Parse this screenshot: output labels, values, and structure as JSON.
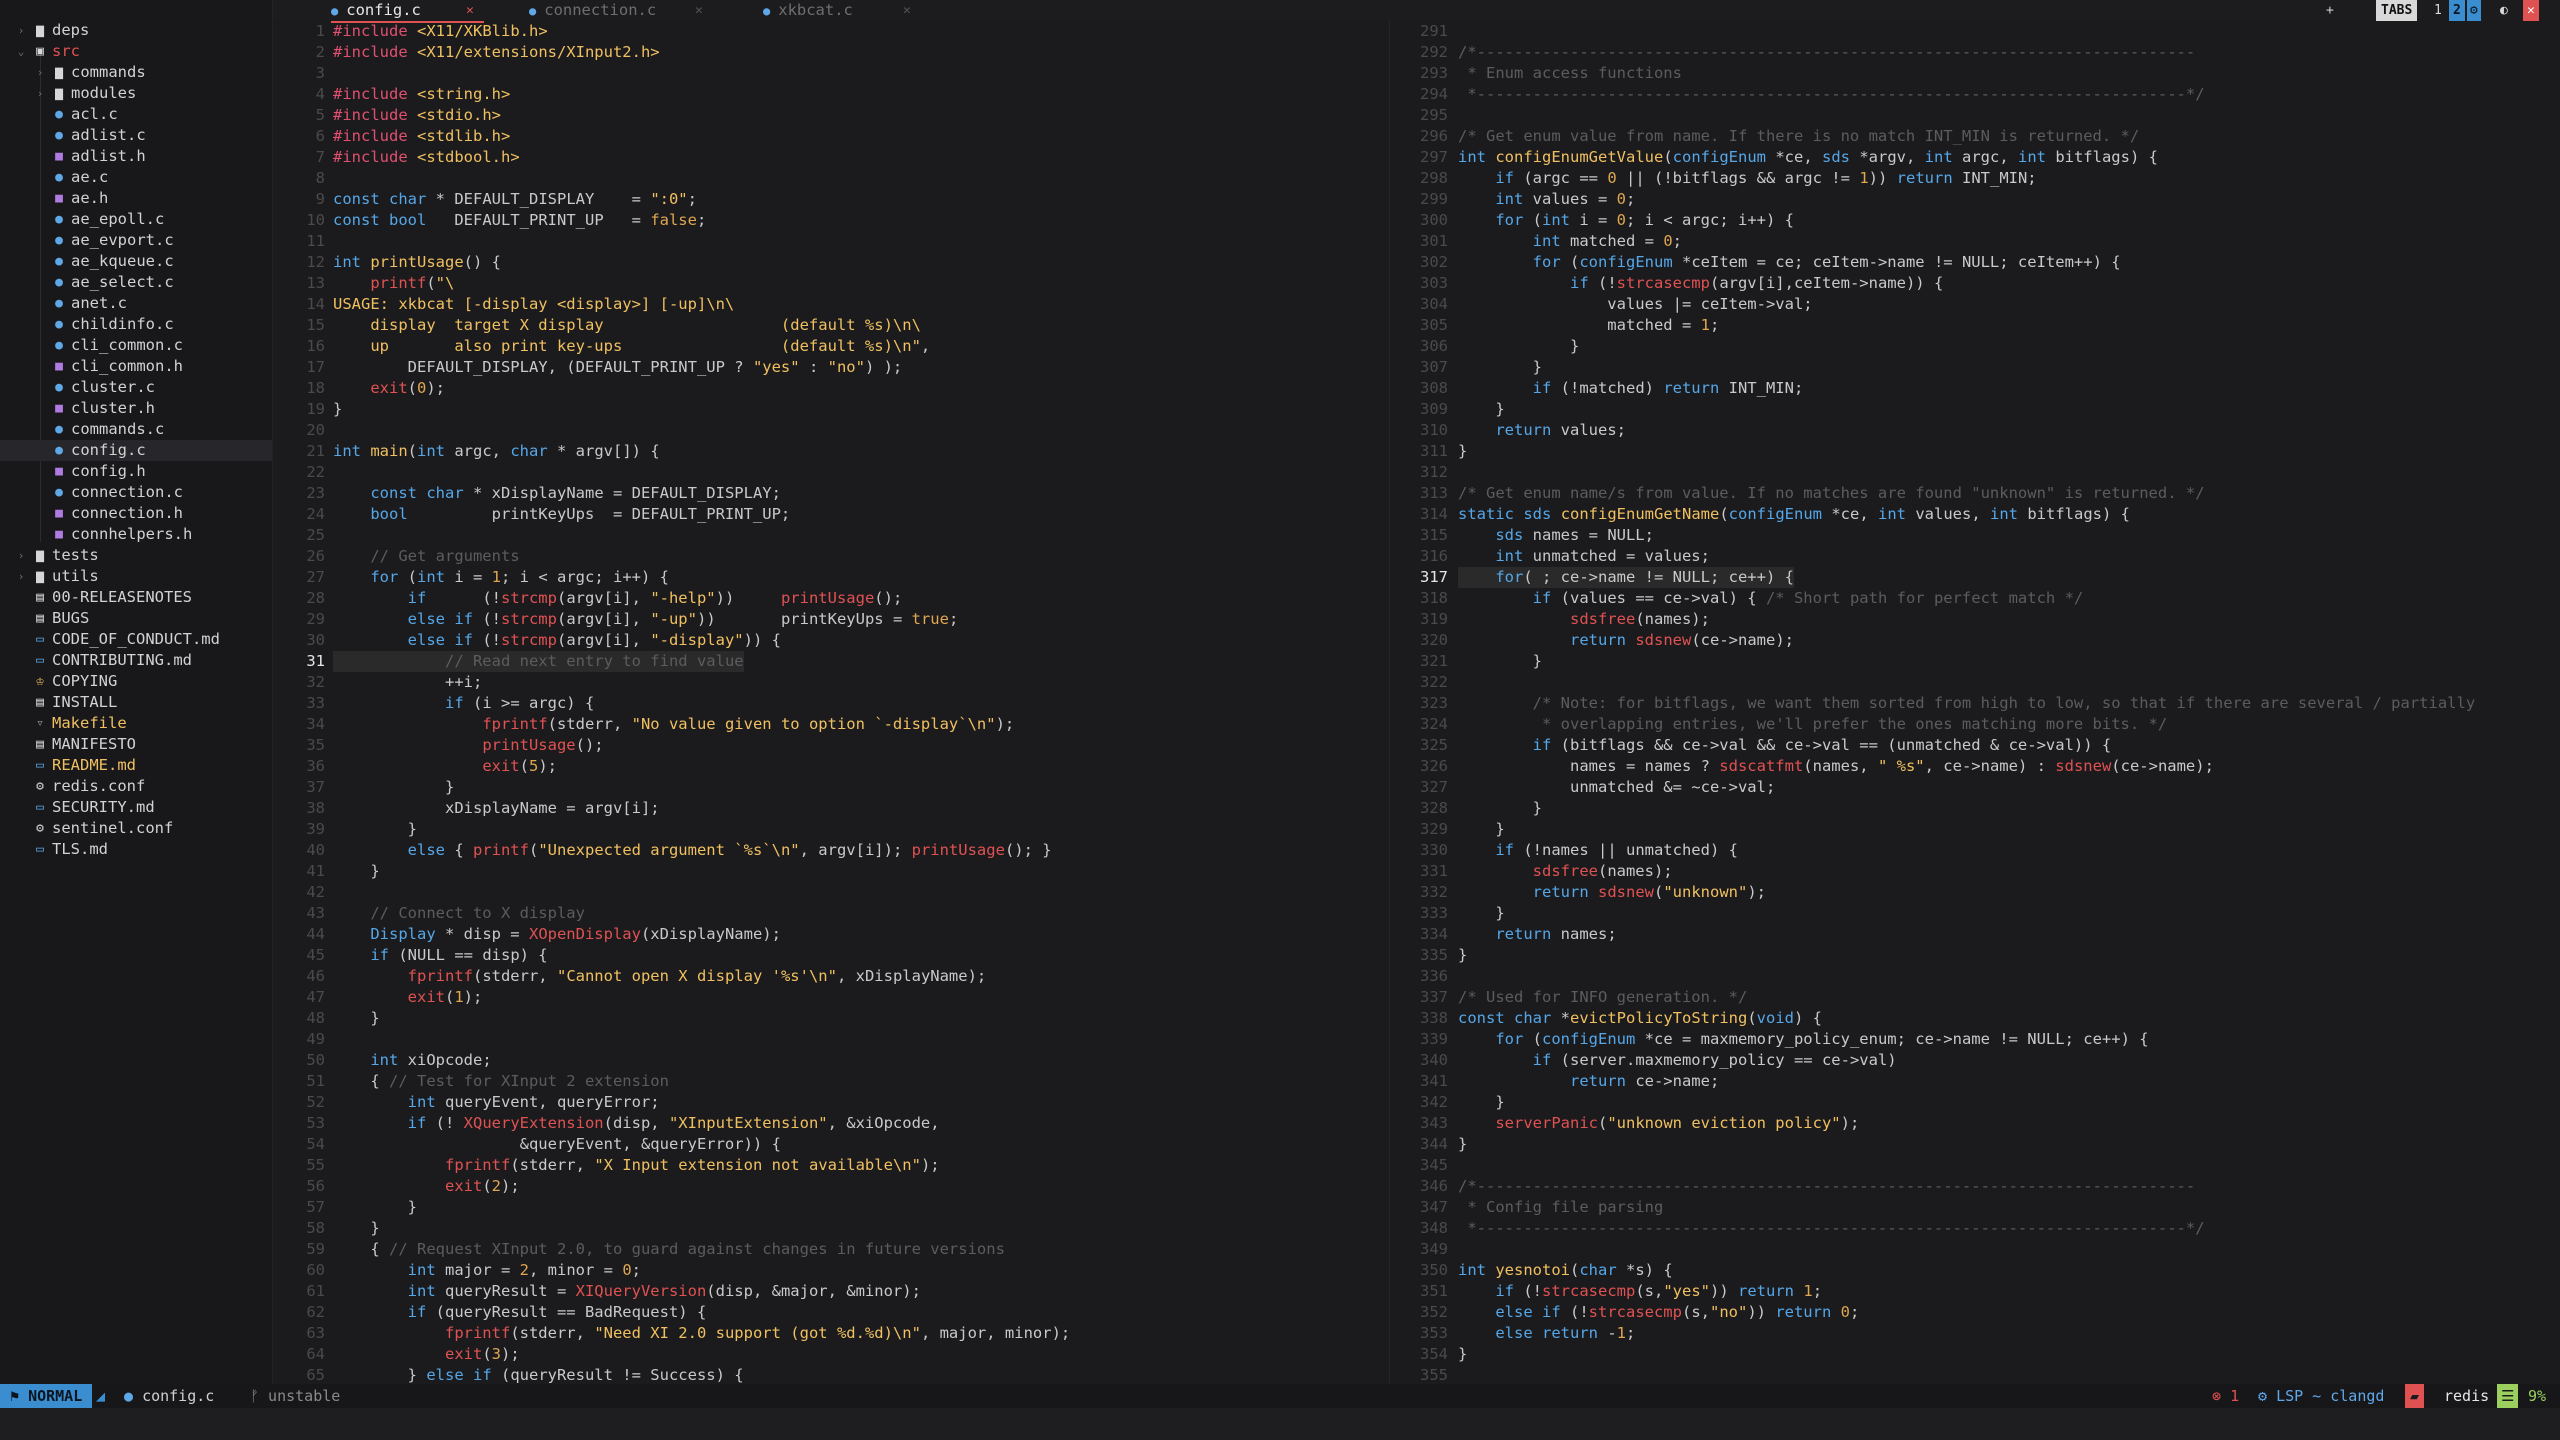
{
  "colors": {
    "accent": "#3a8ed0",
    "error": "#e05252",
    "keyword": "#55a7e8",
    "function": "#f0c060",
    "comment": "#5c5c5c",
    "preproc": "#e0506f"
  },
  "sidebar": {
    "items": [
      {
        "label": "deps",
        "kind": "folder",
        "chev": ">",
        "depth": 0
      },
      {
        "label": "src",
        "kind": "folder-open",
        "chev": "v",
        "depth": 0
      },
      {
        "label": "commands",
        "kind": "folder",
        "chev": ">",
        "depth": 1
      },
      {
        "label": "modules",
        "kind": "folder",
        "chev": ">",
        "depth": 1
      },
      {
        "label": "acl.c",
        "kind": "c",
        "depth": 1
      },
      {
        "label": "adlist.c",
        "kind": "c",
        "depth": 1
      },
      {
        "label": "adlist.h",
        "kind": "h",
        "depth": 1
      },
      {
        "label": "ae.c",
        "kind": "c",
        "depth": 1
      },
      {
        "label": "ae.h",
        "kind": "h",
        "depth": 1
      },
      {
        "label": "ae_epoll.c",
        "kind": "c",
        "depth": 1
      },
      {
        "label": "ae_evport.c",
        "kind": "c",
        "depth": 1
      },
      {
        "label": "ae_kqueue.c",
        "kind": "c",
        "depth": 1
      },
      {
        "label": "ae_select.c",
        "kind": "c",
        "depth": 1
      },
      {
        "label": "anet.c",
        "kind": "c",
        "depth": 1
      },
      {
        "label": "childinfo.c",
        "kind": "c",
        "depth": 1
      },
      {
        "label": "cli_common.c",
        "kind": "c",
        "depth": 1
      },
      {
        "label": "cli_common.h",
        "kind": "h",
        "depth": 1
      },
      {
        "label": "cluster.c",
        "kind": "c",
        "depth": 1
      },
      {
        "label": "cluster.h",
        "kind": "h",
        "depth": 1
      },
      {
        "label": "commands.c",
        "kind": "c",
        "depth": 1
      },
      {
        "label": "config.c",
        "kind": "c",
        "depth": 1,
        "selected": true
      },
      {
        "label": "config.h",
        "kind": "h",
        "depth": 1
      },
      {
        "label": "connection.c",
        "kind": "c",
        "depth": 1
      },
      {
        "label": "connection.h",
        "kind": "h",
        "depth": 1
      },
      {
        "label": "connhelpers.h",
        "kind": "h",
        "depth": 1
      },
      {
        "label": "tests",
        "kind": "folder",
        "chev": ">",
        "depth": 0
      },
      {
        "label": "utils",
        "kind": "folder",
        "chev": ">",
        "depth": 0
      },
      {
        "label": "00-RELEASENOTES",
        "kind": "doc",
        "depth": 0
      },
      {
        "label": "BUGS",
        "kind": "doc",
        "depth": 0
      },
      {
        "label": "CODE_OF_CONDUCT.md",
        "kind": "md",
        "depth": 0
      },
      {
        "label": "CONTRIBUTING.md",
        "kind": "md",
        "depth": 0
      },
      {
        "label": "COPYING",
        "kind": "license",
        "depth": 0
      },
      {
        "label": "INSTALL",
        "kind": "doc",
        "depth": 0
      },
      {
        "label": "Makefile",
        "kind": "make",
        "depth": 0
      },
      {
        "label": "MANIFESTO",
        "kind": "doc",
        "depth": 0
      },
      {
        "label": "README.md",
        "kind": "md-hl",
        "depth": 0
      },
      {
        "label": "redis.conf",
        "kind": "conf",
        "depth": 0
      },
      {
        "label": "SECURITY.md",
        "kind": "md",
        "depth": 0
      },
      {
        "label": "sentinel.conf",
        "kind": "conf",
        "depth": 0
      },
      {
        "label": "TLS.md",
        "kind": "md",
        "depth": 0
      }
    ]
  },
  "tabs": [
    {
      "label": "config.c",
      "active": true
    },
    {
      "label": "connection.c",
      "active": false
    },
    {
      "label": "xkbcat.c",
      "active": false
    }
  ],
  "tabbar_right": {
    "plus": "+",
    "tabs_label": "TABS",
    "n1": "1",
    "n2": "2"
  },
  "left_pane": {
    "first_line": 1,
    "current_line": 31,
    "lines": [
      "<span class='pp'>#include</span> <span class='str'>&lt;X11/XKBlib.h&gt;</span>",
      "<span class='pp'>#include</span> <span class='str'>&lt;X11/extensions/XInput2.h&gt;</span>",
      "",
      "<span class='pp'>#include</span> <span class='str'>&lt;string.h&gt;</span>",
      "<span class='pp'>#include</span> <span class='str'>&lt;stdio.h&gt;</span>",
      "<span class='pp'>#include</span> <span class='str'>&lt;stdlib.h&gt;</span>",
      "<span class='pp'>#include</span> <span class='str'>&lt;stdbool.h&gt;</span>",
      "",
      "<span class='kw'>const</span> <span class='ty'>char</span> * DEFAULT_DISPLAY    = <span class='str'>\":0\"</span>;",
      "<span class='kw'>const</span> <span class='ty'>bool</span>   DEFAULT_PRINT_UP   = <span class='num'>false</span>;",
      "",
      "<span class='ty'>int</span> <span class='fn'>printUsage</span>() {",
      "    <span class='err'>printf</span>(<span class='str'>\"\\</span>",
      "<span class='str'>USAGE: xkbcat [-display &lt;display&gt;] [-up]\\n\\</span>",
      "<span class='str'>    display  target X display                   (default %s)\\n\\</span>",
      "<span class='str'>    up       also print key-ups                 (default %s)\\n\"</span>,",
      "        DEFAULT_DISPLAY, (DEFAULT_PRINT_UP ? <span class='str'>\"yes\"</span> : <span class='str'>\"no\"</span>) );",
      "    <span class='err'>exit</span>(<span class='num'>0</span>);",
      "}",
      "",
      "<span class='ty'>int</span> <span class='fn'>main</span>(<span class='ty'>int</span> argc, <span class='ty'>char</span> * argv[]) {",
      "",
      "    <span class='kw'>const</span> <span class='ty'>char</span> * xDisplayName = DEFAULT_DISPLAY;",
      "    <span class='ty'>bool</span>         printKeyUps  = DEFAULT_PRINT_UP;",
      "",
      "    <span class='cm'>// Get arguments</span>",
      "    <span class='kw'>for</span> (<span class='ty'>int</span> i = <span class='num'>1</span>; i &lt; argc; i++) {",
      "        <span class='kw'>if</span>      (!<span class='err'>strcmp</span>(argv[i], <span class='str'>\"-help\"</span>))     <span class='err'>printUsage</span>();",
      "        <span class='kw'>else if</span> (!<span class='err'>strcmp</span>(argv[i], <span class='str'>\"-up\"</span>))       printKeyUps = <span class='num'>true</span>;",
      "        <span class='kw'>else if</span> (!<span class='err'>strcmp</span>(argv[i], <span class='str'>\"-display\"</span>)) {",
      "            <span class='cm'>// Read next entry to find value</span>",
      "            ++i;",
      "            <span class='kw'>if</span> (i &gt;= argc) {",
      "                <span class='err'>fprintf</span>(stderr, <span class='str'>\"No value given to option `-display`\\n\"</span>);",
      "                <span class='err'>printUsage</span>();",
      "                <span class='err'>exit</span>(<span class='num'>5</span>);",
      "            }",
      "            xDisplayName = argv[i];",
      "        }",
      "        <span class='kw'>else</span> { <span class='err'>printf</span>(<span class='str'>\"Unexpected argument `%s`\\n\"</span>, argv[i]); <span class='err'>printUsage</span>(); }",
      "    }",
      "",
      "    <span class='cm'>// Connect to X display</span>",
      "    <span class='ty'>Display</span> * disp = <span class='err'>XOpenDisplay</span>(xDisplayName);",
      "    <span class='kw'>if</span> (NULL == disp) {",
      "        <span class='err'>fprintf</span>(stderr, <span class='str'>\"Cannot open X display '%s'\\n\"</span>, xDisplayName);",
      "        <span class='err'>exit</span>(<span class='num'>1</span>);",
      "    }",
      "",
      "    <span class='ty'>int</span> xiOpcode;",
      "    { <span class='cm'>// Test for XInput 2 extension</span>",
      "        <span class='ty'>int</span> queryEvent, queryError;",
      "        <span class='kw'>if</span> (! <span class='err'>XQueryExtension</span>(disp, <span class='str'>\"XInputExtension\"</span>, &amp;xiOpcode,",
      "                    &amp;queryEvent, &amp;queryError)) {",
      "            <span class='err'>fprintf</span>(stderr, <span class='str'>\"X Input extension not available\\n\"</span>);",
      "            <span class='err'>exit</span>(<span class='num'>2</span>);",
      "        }",
      "    }",
      "    { <span class='cm'>// Request XInput 2.0, to guard against changes in future versions</span>",
      "        <span class='ty'>int</span> major = <span class='num'>2</span>, minor = <span class='num'>0</span>;",
      "        <span class='ty'>int</span> queryResult = <span class='err'>XIQueryVersion</span>(disp, &amp;major, &amp;minor);",
      "        <span class='kw'>if</span> (queryResult == BadRequest) {",
      "            <span class='err'>fprintf</span>(stderr, <span class='str'>\"Need XI 2.0 support (got %d.%d)\\n\"</span>, major, minor);",
      "            <span class='err'>exit</span>(<span class='num'>3</span>);",
      "        } <span class='kw'>else if</span> (queryResult != Success) {"
    ]
  },
  "right_pane": {
    "first_line": 291,
    "current_line": 317,
    "lines": [
      "",
      "<span class='cm'>/*-----------------------------------------------------------------------------</span>",
      "<span class='cm'> * Enum access functions</span>",
      "<span class='cm'> *----------------------------------------------------------------------------*/</span>",
      "",
      "<span class='cm'>/* Get enum value from name. If there is no match INT_MIN is returned. */</span>",
      "<span class='ty'>int</span> <span class='fn'>configEnumGetValue</span>(<span class='ty'>configEnum</span> *ce, <span class='ty'>sds</span> *argv, <span class='ty'>int</span> argc, <span class='ty'>int</span> bitflags) {",
      "    <span class='kw'>if</span> (argc == <span class='num'>0</span> || (!bitflags &amp;&amp; argc != <span class='num'>1</span>)) <span class='kw'>return</span> INT_MIN;",
      "    <span class='ty'>int</span> values = <span class='num'>0</span>;",
      "    <span class='kw'>for</span> (<span class='ty'>int</span> i = <span class='num'>0</span>; i &lt; argc; i++) {",
      "        <span class='ty'>int</span> matched = <span class='num'>0</span>;",
      "        <span class='kw'>for</span> (<span class='ty'>configEnum</span> *ceItem = ce; ceItem-&gt;name != NULL; ceItem++) {",
      "            <span class='kw'>if</span> (!<span class='err'>strcasecmp</span>(argv[i],ceItem-&gt;name)) {",
      "                values |= ceItem-&gt;val;",
      "                matched = <span class='num'>1</span>;",
      "            }",
      "        }",
      "        <span class='kw'>if</span> (!matched) <span class='kw'>return</span> INT_MIN;",
      "    }",
      "    <span class='kw'>return</span> values;",
      "}",
      "",
      "<span class='cm'>/* Get enum name/s from value. If no matches are found \"unknown\" is returned. */</span>",
      "<span class='kw'>static</span> <span class='ty'>sds</span> <span class='fn'>configEnumGetName</span>(<span class='ty'>configEnum</span> *ce, <span class='ty'>int</span> values, <span class='ty'>int</span> bitflags) {",
      "    <span class='ty'>sds</span> names = NULL;",
      "    <span class='ty'>int</span> unmatched = values;",
      "    <span class='kw'>for</span>( ; ce-&gt;name != NULL; ce++) {",
      "        <span class='kw'>if</span> (values == ce-&gt;val) { <span class='cm'>/* Short path for perfect match */</span>",
      "            <span class='err'>sdsfree</span>(names);",
      "            <span class='kw'>return</span> <span class='err'>sdsnew</span>(ce-&gt;name);",
      "        }",
      "",
      "        <span class='cm'>/* Note: for bitflags, we want them sorted from high to low, so that if there are several / partially</span>",
      "<span class='cm'>         * overlapping entries, we'll prefer the ones matching more bits. */</span>",
      "        <span class='kw'>if</span> (bitflags &amp;&amp; ce-&gt;val &amp;&amp; ce-&gt;val == (unmatched &amp; ce-&gt;val)) {",
      "            names = names ? <span class='err'>sdscatfmt</span>(names, <span class='str'>\" %s\"</span>, ce-&gt;name) : <span class='err'>sdsnew</span>(ce-&gt;name);",
      "            unmatched &amp;= ~ce-&gt;val;",
      "        }",
      "    }",
      "    <span class='kw'>if</span> (!names || unmatched) {",
      "        <span class='err'>sdsfree</span>(names);",
      "        <span class='kw'>return</span> <span class='err'>sdsnew</span>(<span class='str'>\"unknown\"</span>);",
      "    }",
      "    <span class='kw'>return</span> names;",
      "}",
      "",
      "<span class='cm'>/* Used for INFO generation. */</span>",
      "<span class='kw'>const</span> <span class='ty'>char</span> *<span class='fn'>evictPolicyToString</span>(<span class='ty'>void</span>) {",
      "    <span class='kw'>for</span> (<span class='ty'>configEnum</span> *ce = maxmemory_policy_enum; ce-&gt;name != NULL; ce++) {",
      "        <span class='kw'>if</span> (server.maxmemory_policy == ce-&gt;val)",
      "            <span class='kw'>return</span> ce-&gt;name;",
      "    }",
      "    <span class='err'>serverPanic</span>(<span class='str'>\"unknown eviction policy\"</span>);",
      "}",
      "",
      "<span class='cm'>/*-----------------------------------------------------------------------------</span>",
      "<span class='cm'> * Config file parsing</span>",
      "<span class='cm'> *----------------------------------------------------------------------------*/</span>",
      "",
      "<span class='ty'>int</span> <span class='fn'>yesnotoi</span>(<span class='ty'>char</span> *s) {",
      "    <span class='kw'>if</span> (!<span class='err'>strcasecmp</span>(s,<span class='str'>\"yes\"</span>)) <span class='kw'>return</span> <span class='num'>1</span>;",
      "    <span class='kw'>else if</span> (!<span class='err'>strcasecmp</span>(s,<span class='str'>\"no\"</span>)) <span class='kw'>return</span> <span class='num'>0</span>;",
      "    <span class='kw'>else return</span> -<span class='num'>1</span>;",
      "}",
      ""
    ]
  },
  "status": {
    "mode": "NORMAL",
    "file": "config.c",
    "branch": "unstable",
    "errors": "1",
    "lsp": "LSP ~ clangd",
    "project": "redis",
    "percent": "9%"
  }
}
